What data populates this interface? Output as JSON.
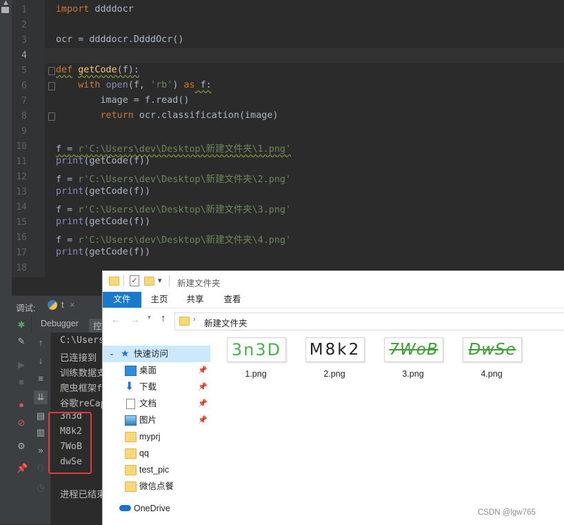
{
  "editor": {
    "line_numbers": [
      "1",
      "2",
      "3",
      "4",
      "5",
      "6",
      "7",
      "8",
      "9",
      "10",
      "11",
      "12",
      "13",
      "14",
      "15",
      "16",
      "17",
      "18"
    ],
    "lines": {
      "l1_kw": "import",
      "l1_rest": " ddddocr",
      "l3": "ocr = ddddocr.DdddOcr()",
      "l5_kw": "def",
      "l5_fn": "getCode",
      "l5_rest": "(f):",
      "l6_kw": "with",
      "l6_fn": "open",
      "l6_a": "(f, ",
      "l6_str": "'rb'",
      "l6_b": ") ",
      "l6_kw2": "as",
      "l6_c": " f:",
      "l7": "image = f.read()",
      "l8_kw": "return",
      "l8_rest": " ocr.classification(image)",
      "assign_prefix": "f = ",
      "path1": "r'C:\\Users\\dev\\Desktop\\新建文件夹\\1.png'",
      "path2": "r'C:\\Users\\dev\\Desktop\\新建文件夹\\2.png'",
      "path3": "r'C:\\Users\\dev\\Desktop\\新建文件夹\\3.png'",
      "path4": "r'C:\\Users\\dev\\Desktop\\新建文件夹\\4.png'",
      "print_kw": "print",
      "print_rest": "(getCode(f))"
    }
  },
  "debug": {
    "label": "调试:",
    "run_name": "t",
    "close": "×",
    "tab_debugger": "Debugger",
    "tab_console": "控",
    "console_lines": [
      "C:\\Users",
      "已连接到",
      "训练数据支",
      "爬虫框架f",
      "谷歌reCap",
      "3n3d",
      "M8k2",
      "7WoB",
      "dwSe",
      "",
      "进程已结束"
    ]
  },
  "explorer": {
    "title": "新建文件夹",
    "ribbon_tabs": [
      "文件",
      "主页",
      "共享",
      "查看"
    ],
    "address": "新建文件夹",
    "nav": [
      {
        "label": "快速访问",
        "icon": "star-icon"
      },
      {
        "label": "桌面",
        "icon": "desktop-icon",
        "pinned": true
      },
      {
        "label": "下载",
        "icon": "download-icon",
        "pinned": true
      },
      {
        "label": "文档",
        "icon": "document-icon",
        "pinned": true
      },
      {
        "label": "图片",
        "icon": "pictures-icon",
        "pinned": true
      },
      {
        "label": "myprj",
        "icon": "folder-icon"
      },
      {
        "label": "qq",
        "icon": "folder-icon"
      },
      {
        "label": "test_pic",
        "icon": "folder-icon"
      },
      {
        "label": "微信点餐",
        "icon": "folder-icon"
      },
      {
        "label": "OneDrive",
        "icon": "cloud-icon"
      }
    ],
    "files": [
      {
        "name": "1.png",
        "captcha": "3n3D",
        "color": "#4caf50"
      },
      {
        "name": "2.png",
        "captcha": "M8k2",
        "color": "#222222"
      },
      {
        "name": "3.png",
        "captcha": "7WoB",
        "color": "#3aa02f"
      },
      {
        "name": "4.png",
        "captcha": "DwSe",
        "color": "#3aa02f"
      }
    ]
  },
  "watermark": "CSDN @lgw765",
  "colors": {
    "editor_bg": "#2b2b2b",
    "keyword": "#cc7832",
    "function": "#ffc66d",
    "string": "#6a8759",
    "builtin": "#8888c6",
    "highlight_box": "#e53935",
    "ribbon_file": "#1979ca"
  }
}
